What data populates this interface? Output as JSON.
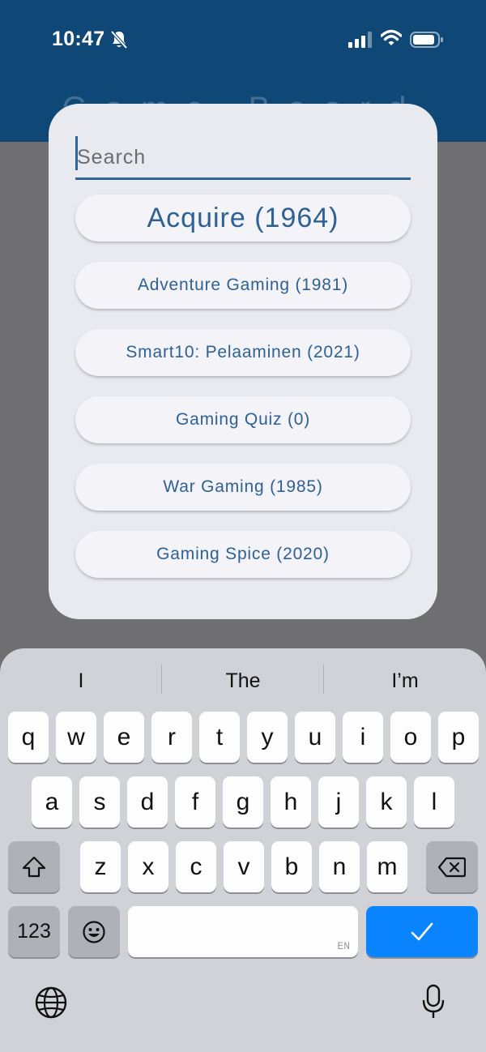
{
  "status_bar": {
    "time": "10:47"
  },
  "header": {
    "title": "Game Board"
  },
  "search": {
    "placeholder": "Search",
    "value": ""
  },
  "results": [
    {
      "label": "Acquire (1964)"
    },
    {
      "label": "Adventure Gaming (1981)"
    },
    {
      "label": "Smart10: Pelaaminen (2021)"
    },
    {
      "label": "Gaming Quiz (0)"
    },
    {
      "label": "War Gaming (1985)"
    },
    {
      "label": "Gaming Spice (2020)"
    }
  ],
  "keyboard": {
    "suggestions": [
      "I",
      "The",
      "I’m"
    ],
    "row1": [
      "q",
      "w",
      "e",
      "r",
      "t",
      "y",
      "u",
      "i",
      "o",
      "p"
    ],
    "row2": [
      "a",
      "s",
      "d",
      "f",
      "g",
      "h",
      "j",
      "k",
      "l"
    ],
    "row3": [
      "z",
      "x",
      "c",
      "v",
      "b",
      "n",
      "m"
    ],
    "numbers_label": "123",
    "lang_label": "EN",
    "done_icon": "checkmark",
    "accent": "#0a84ff"
  },
  "colors": {
    "header": "#0f4876",
    "accent": "#2f6599",
    "overlay": "#6f6f71"
  }
}
